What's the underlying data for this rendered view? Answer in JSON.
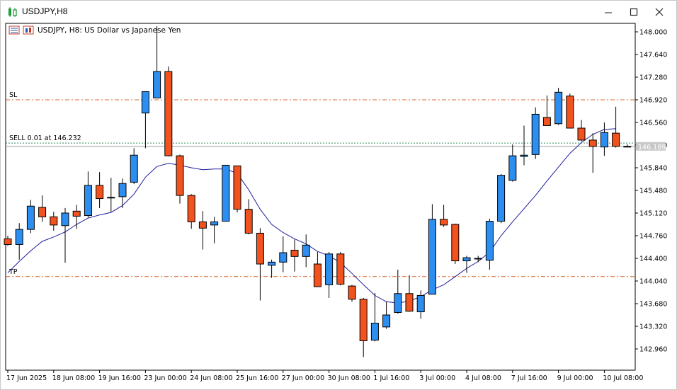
{
  "window": {
    "title": "USDJPY,H8",
    "minimize_icon": "minimize-icon",
    "maximize_icon": "maximize-icon",
    "close_icon": "close-icon"
  },
  "chart_info": {
    "text": "USDJPY, H8:  US Dollar vs Japanese Yen"
  },
  "colors": {
    "bull": "#2c8ef0",
    "bear": "#f2521e",
    "ma": "#1d1d9a",
    "order_line": "#d8672c",
    "grid_bg": "#ffffff",
    "price_label_bg": "#c8c8c8"
  },
  "chart_data": {
    "type": "candlestick",
    "ylim": [
      142.72,
      148.09
    ],
    "y_ticks": [
      "148.000",
      "147.640",
      "147.280",
      "146.920",
      "146.560",
      "146.200",
      "145.840",
      "145.480",
      "145.120",
      "144.760",
      "144.400",
      "144.040",
      "143.680",
      "143.320",
      "142.960"
    ],
    "x_ticks": [
      {
        "label": "17 Jun 2025",
        "index": 0
      },
      {
        "label": "18 Jun 08:00",
        "index": 4
      },
      {
        "label": "19 Jun 16:00",
        "index": 8
      },
      {
        "label": "23 Jun 00:00",
        "index": 12
      },
      {
        "label": "24 Jun 08:00",
        "index": 16
      },
      {
        "label": "25 Jun 16:00",
        "index": 20
      },
      {
        "label": "27 Jun 00:00",
        "index": 24
      },
      {
        "label": "30 Jun 08:00",
        "index": 28
      },
      {
        "label": "1 Jul 16:00",
        "index": 32
      },
      {
        "label": "3 Jul 00:00",
        "index": 36
      },
      {
        "label": "4 Jul 08:00",
        "index": 40
      },
      {
        "label": "7 Jul 16:00",
        "index": 44
      },
      {
        "label": "9 Jul 00:00",
        "index": 48
      },
      {
        "label": "10 Jul 08:00",
        "index": 52
      }
    ],
    "candles": [
      {
        "o": 144.71,
        "h": 144.76,
        "l": 144.6,
        "c": 144.62
      },
      {
        "o": 144.62,
        "h": 144.96,
        "l": 144.38,
        "c": 144.86
      },
      {
        "o": 144.86,
        "h": 145.33,
        "l": 144.8,
        "c": 145.23
      },
      {
        "o": 145.21,
        "h": 145.4,
        "l": 144.98,
        "c": 145.06
      },
      {
        "o": 145.06,
        "h": 145.14,
        "l": 144.84,
        "c": 144.93
      },
      {
        "o": 144.92,
        "h": 145.2,
        "l": 144.33,
        "c": 145.12
      },
      {
        "o": 145.15,
        "h": 145.25,
        "l": 144.87,
        "c": 145.07
      },
      {
        "o": 145.08,
        "h": 145.78,
        "l": 145.05,
        "c": 145.56
      },
      {
        "o": 145.56,
        "h": 145.77,
        "l": 145.2,
        "c": 145.35
      },
      {
        "o": 145.37,
        "h": 145.68,
        "l": 145.14,
        "c": 145.36
      },
      {
        "o": 145.38,
        "h": 145.67,
        "l": 145.2,
        "c": 145.59
      },
      {
        "o": 145.61,
        "h": 146.15,
        "l": 145.58,
        "c": 146.04
      },
      {
        "o": 146.71,
        "h": 147.0,
        "l": 146.15,
        "c": 147.05
      },
      {
        "o": 146.95,
        "h": 148.09,
        "l": 146.95,
        "c": 147.37
      },
      {
        "o": 147.37,
        "h": 147.45,
        "l": 146.02,
        "c": 146.03
      },
      {
        "o": 146.03,
        "h": 146.05,
        "l": 145.27,
        "c": 145.4
      },
      {
        "o": 145.4,
        "h": 145.42,
        "l": 144.87,
        "c": 144.98
      },
      {
        "o": 144.98,
        "h": 145.15,
        "l": 144.54,
        "c": 144.88
      },
      {
        "o": 144.93,
        "h": 145.06,
        "l": 144.64,
        "c": 144.98
      },
      {
        "o": 144.99,
        "h": 145.88,
        "l": 144.99,
        "c": 145.88
      },
      {
        "o": 145.87,
        "h": 145.87,
        "l": 145.13,
        "c": 145.18
      },
      {
        "o": 145.18,
        "h": 145.34,
        "l": 144.78,
        "c": 144.8
      },
      {
        "o": 144.8,
        "h": 144.88,
        "l": 143.73,
        "c": 144.31
      },
      {
        "o": 144.29,
        "h": 144.38,
        "l": 144.09,
        "c": 144.34
      },
      {
        "o": 144.34,
        "h": 144.75,
        "l": 144.18,
        "c": 144.49
      },
      {
        "o": 144.53,
        "h": 144.7,
        "l": 144.19,
        "c": 144.43
      },
      {
        "o": 144.43,
        "h": 144.78,
        "l": 144.26,
        "c": 144.61
      },
      {
        "o": 144.31,
        "h": 144.5,
        "l": 143.96,
        "c": 143.95
      },
      {
        "o": 143.98,
        "h": 144.5,
        "l": 143.77,
        "c": 144.47
      },
      {
        "o": 144.47,
        "h": 144.5,
        "l": 143.97,
        "c": 143.99
      },
      {
        "o": 143.96,
        "h": 143.98,
        "l": 143.71,
        "c": 143.75
      },
      {
        "o": 143.75,
        "h": 143.77,
        "l": 142.83,
        "c": 143.09
      },
      {
        "o": 143.1,
        "h": 143.85,
        "l": 143.08,
        "c": 143.37
      },
      {
        "o": 143.31,
        "h": 143.71,
        "l": 143.28,
        "c": 143.5
      },
      {
        "o": 143.54,
        "h": 144.22,
        "l": 143.52,
        "c": 143.84
      },
      {
        "o": 143.84,
        "h": 144.13,
        "l": 143.55,
        "c": 143.56
      },
      {
        "o": 143.55,
        "h": 143.89,
        "l": 143.44,
        "c": 143.81
      },
      {
        "o": 143.83,
        "h": 145.26,
        "l": 143.83,
        "c": 145.02
      },
      {
        "o": 145.02,
        "h": 145.25,
        "l": 144.9,
        "c": 144.93
      },
      {
        "o": 144.94,
        "h": 144.95,
        "l": 144.31,
        "c": 144.36
      },
      {
        "o": 144.36,
        "h": 144.44,
        "l": 144.17,
        "c": 144.41
      },
      {
        "o": 144.4,
        "h": 144.44,
        "l": 144.34,
        "c": 144.4
      },
      {
        "o": 144.37,
        "h": 145.03,
        "l": 144.22,
        "c": 144.99
      },
      {
        "o": 144.99,
        "h": 145.74,
        "l": 144.96,
        "c": 145.72
      },
      {
        "o": 145.64,
        "h": 146.21,
        "l": 145.62,
        "c": 146.03
      },
      {
        "o": 146.02,
        "h": 146.51,
        "l": 145.88,
        "c": 146.04
      },
      {
        "o": 146.05,
        "h": 146.8,
        "l": 145.98,
        "c": 146.69
      },
      {
        "o": 146.64,
        "h": 146.99,
        "l": 146.51,
        "c": 146.51
      },
      {
        "o": 146.54,
        "h": 147.11,
        "l": 146.52,
        "c": 147.04
      },
      {
        "o": 146.98,
        "h": 147.02,
        "l": 146.49,
        "c": 146.47
      },
      {
        "o": 146.47,
        "h": 146.6,
        "l": 146.26,
        "c": 146.28
      },
      {
        "o": 146.28,
        "h": 146.39,
        "l": 145.76,
        "c": 146.18
      },
      {
        "o": 146.17,
        "h": 146.56,
        "l": 146.03,
        "c": 146.4
      },
      {
        "o": 146.39,
        "h": 146.81,
        "l": 146.16,
        "c": 146.18
      },
      {
        "o": 146.17,
        "h": 146.21,
        "l": 146.17,
        "c": 146.18
      }
    ],
    "ma": [
      144.17,
      144.35,
      144.52,
      144.67,
      144.74,
      144.82,
      144.94,
      145.04,
      145.09,
      145.13,
      145.24,
      145.42,
      145.69,
      145.86,
      145.91,
      145.88,
      145.84,
      145.81,
      145.82,
      145.82,
      145.75,
      145.49,
      145.18,
      144.94,
      144.81,
      144.71,
      144.63,
      144.51,
      144.44,
      144.33,
      144.16,
      143.98,
      143.81,
      143.71,
      143.69,
      143.72,
      143.79,
      143.9,
      143.98,
      144.11,
      144.24,
      144.35,
      144.5,
      144.76,
      144.98,
      145.19,
      145.4,
      145.63,
      145.85,
      146.07,
      146.24,
      146.37,
      146.45,
      146.46
    ],
    "orders": [
      {
        "label": "SL",
        "price": 146.92
      },
      {
        "label": "SELL 0.01 at 146.232",
        "price": 146.232
      },
      {
        "label": "TP",
        "price": 144.11
      }
    ],
    "bid_price": 146.232,
    "ask_price": 146.18,
    "current_price_label": "146.189"
  }
}
